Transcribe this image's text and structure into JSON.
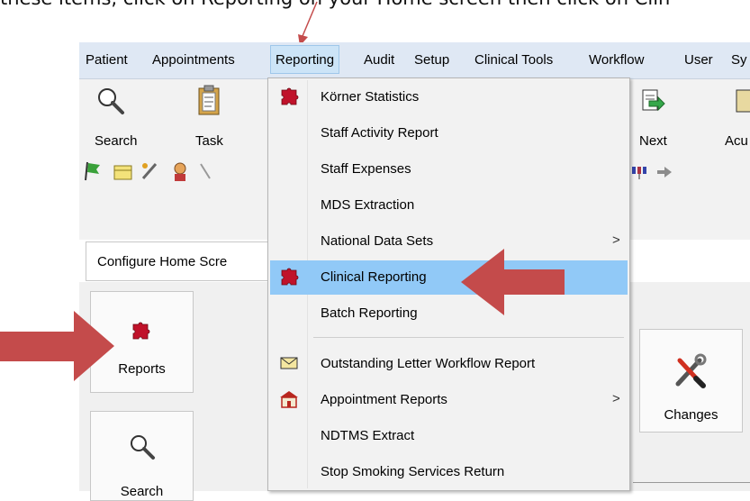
{
  "caption": {
    "text": "these items, click on Reporting on your Home screen then click on Clin"
  },
  "menubar": {
    "items": [
      "Patient",
      "Appointments",
      "Reporting",
      "Audit",
      "Setup",
      "Clinical Tools",
      "Workflow",
      "User",
      "Sy"
    ],
    "active": "Reporting"
  },
  "toolbar": {
    "search_label": "Search",
    "task_label": "Task",
    "next_label": "Next",
    "acu_label": "Acu"
  },
  "home": {
    "configure_label": "Configure Home Scre",
    "reports_tile": "Reports",
    "search_tile": "Search",
    "changes_tile": "Changes"
  },
  "reporting_menu": {
    "items": [
      {
        "label": "Körner Statistics",
        "icon": "puzzle-icon",
        "submenu": false
      },
      {
        "label": "Staff Activity Report",
        "icon": "",
        "submenu": false
      },
      {
        "label": "Staff Expenses",
        "icon": "",
        "submenu": false
      },
      {
        "label": "MDS Extraction",
        "icon": "",
        "submenu": false
      },
      {
        "label": "National Data Sets",
        "icon": "",
        "submenu": true
      },
      {
        "label": "Clinical Reporting",
        "icon": "puzzle-icon",
        "submenu": false,
        "highlighted": true
      },
      {
        "label": "Batch Reporting",
        "icon": "",
        "submenu": false
      },
      {
        "label": "Outstanding Letter Workflow Report",
        "icon": "envelope-icon",
        "submenu": false
      },
      {
        "label": "Appointment Reports",
        "icon": "building-icon",
        "submenu": true
      },
      {
        "label": "NDTMS Extract",
        "icon": "",
        "submenu": false
      },
      {
        "label": "Stop Smoking Services Return",
        "icon": "",
        "submenu": false
      }
    ],
    "submenu_glyph": ">"
  },
  "colors": {
    "arrow": "#c44b4b",
    "highlight": "#91c9f7",
    "menubar": "#dfe8f4"
  }
}
